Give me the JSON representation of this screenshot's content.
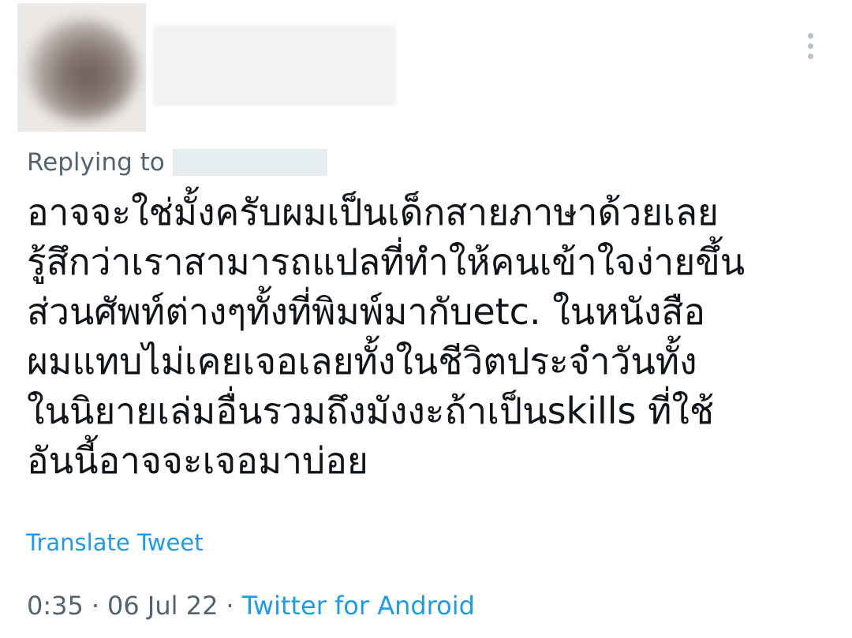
{
  "tweet": {
    "replying_to_label": "Replying to",
    "lines": [
      "อาจจะใช่มั้งครับผมเป็นเด็กสายภาษาด้วยเลย",
      "รู้สึกว่าเราสามารถแปลที่ทำให้คนเข้าใจง่ายขึ้น",
      "ส่วนศัพท์ต่างๆทั้งที่พิมพ์มากับetc. ในหนังสือ",
      "ผมแทบไม่เคยเจอเลยทั้งในชีวิตประจำวันทั้ง",
      "ในนิยายเล่มอื่นรวมถึงมังงะถ้าเป็นskills ที่ใช้",
      "อันนี้อาจจะเจอมาบ่อย"
    ],
    "translate_label": "Translate Tweet",
    "time": "0:35",
    "separator": "·",
    "date": "06 Jul 22",
    "source": "Twitter for Android"
  },
  "icons": {
    "more": "more-vertical-icon"
  },
  "colors": {
    "text": "#0f1419",
    "secondary": "#536471",
    "accent": "#1d9bf0"
  }
}
